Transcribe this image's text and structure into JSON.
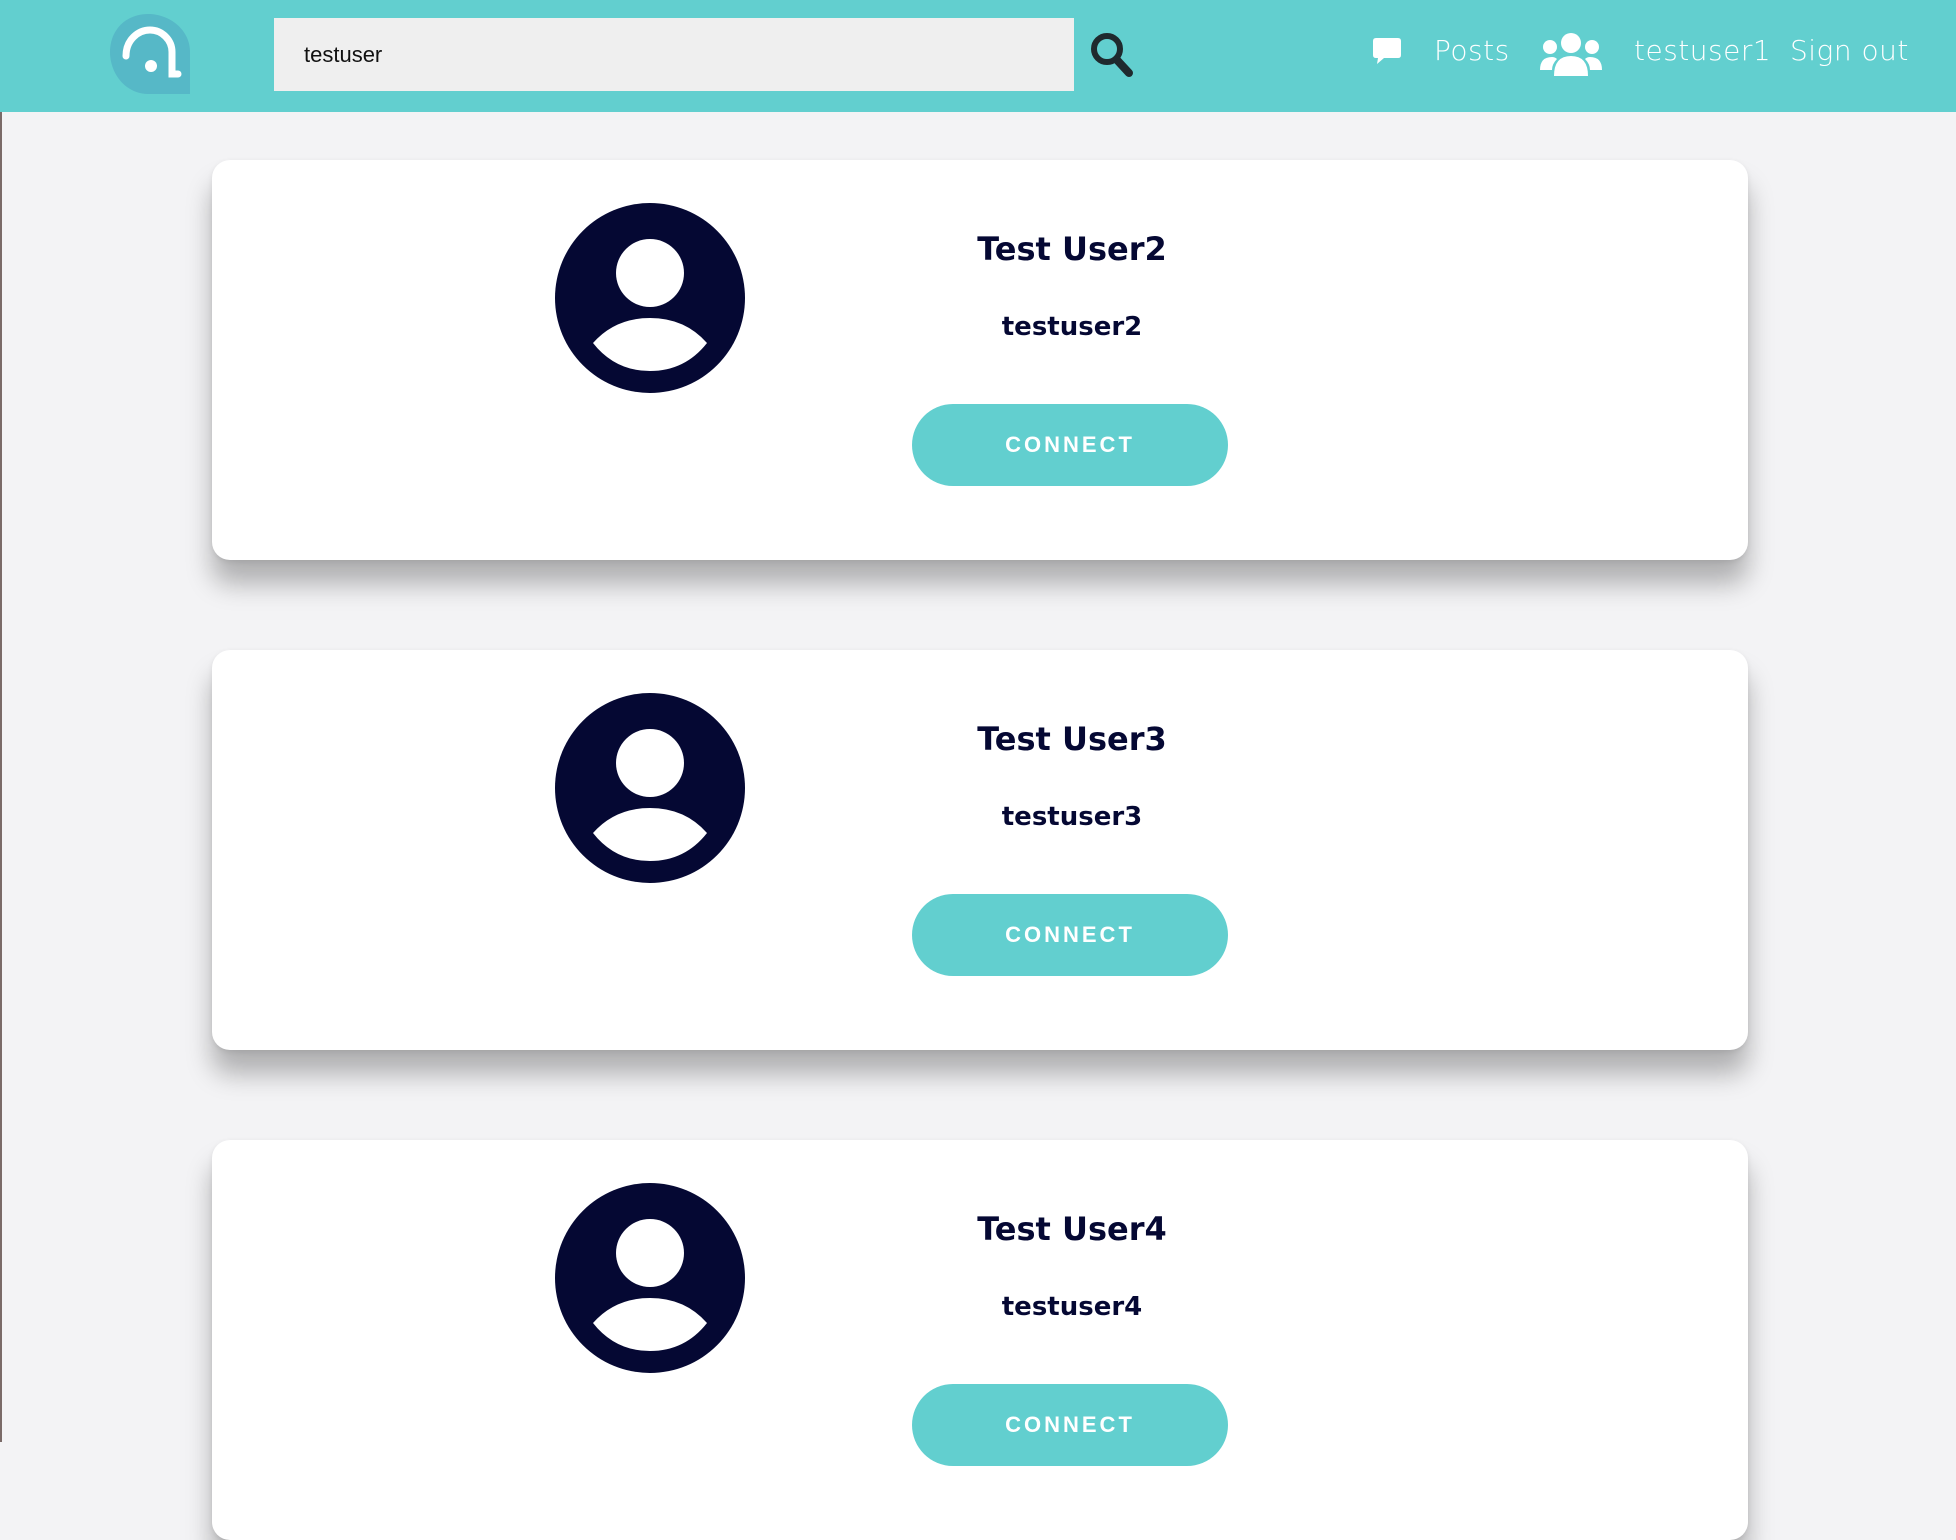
{
  "search": {
    "value": "testuser",
    "icon": "search-icon"
  },
  "nav": {
    "posts_icon": "speech-bubble-icon",
    "posts_label": "Posts",
    "users_icon": "users-group-icon",
    "username_label": "testuser1",
    "signout_label": "Sign out"
  },
  "colors": {
    "brand": "#62cfcf",
    "text_dark": "#050833",
    "avatar": "#050833"
  },
  "results": [
    {
      "name": "Test User2",
      "username": "testuser2",
      "button_label": "CONNECT"
    },
    {
      "name": "Test User3",
      "username": "testuser3",
      "button_label": "CONNECT"
    },
    {
      "name": "Test User4",
      "username": "testuser4",
      "button_label": "CONNECT"
    }
  ]
}
